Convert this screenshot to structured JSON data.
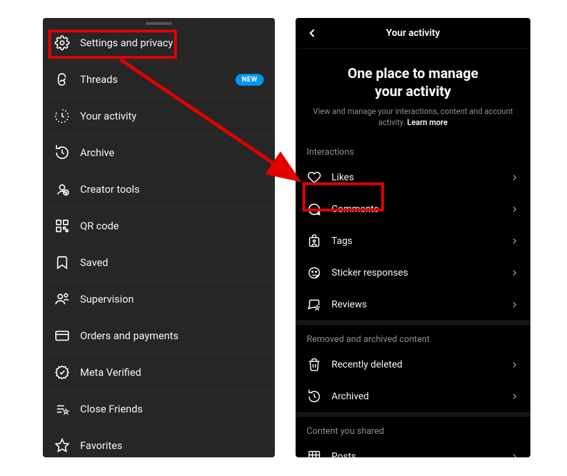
{
  "leftPanel": {
    "items": [
      {
        "label": "Settings and privacy",
        "icon": "gear"
      },
      {
        "label": "Threads",
        "icon": "threads",
        "badge": "NEW"
      },
      {
        "label": "Your activity",
        "icon": "activity"
      },
      {
        "label": "Archive",
        "icon": "archive"
      },
      {
        "label": "Creator tools",
        "icon": "creator"
      },
      {
        "label": "QR code",
        "icon": "qrcode"
      },
      {
        "label": "Saved",
        "icon": "bookmark"
      },
      {
        "label": "Supervision",
        "icon": "supervision"
      },
      {
        "label": "Orders and payments",
        "icon": "card"
      },
      {
        "label": "Meta Verified",
        "icon": "verified"
      },
      {
        "label": "Close Friends",
        "icon": "closefriends"
      },
      {
        "label": "Favorites",
        "icon": "star"
      }
    ]
  },
  "rightPanel": {
    "headerTitle": "Your activity",
    "heroTitle1": "One place to manage",
    "heroTitle2": "your activity",
    "heroSub": "View and manage your interactions, content and account activity.",
    "learnMore": "Learn more",
    "sections": [
      {
        "title": "Interactions",
        "items": [
          {
            "label": "Likes",
            "icon": "heart"
          },
          {
            "label": "Comments",
            "icon": "comment"
          },
          {
            "label": "Tags",
            "icon": "tag"
          },
          {
            "label": "Sticker responses",
            "icon": "sticker"
          },
          {
            "label": "Reviews",
            "icon": "review"
          }
        ]
      },
      {
        "title": "Removed and archived content",
        "items": [
          {
            "label": "Recently deleted",
            "icon": "trash"
          },
          {
            "label": "Archived",
            "icon": "archive"
          }
        ]
      },
      {
        "title": "Content you shared",
        "items": [
          {
            "label": "Posts",
            "icon": "grid"
          }
        ]
      }
    ]
  }
}
